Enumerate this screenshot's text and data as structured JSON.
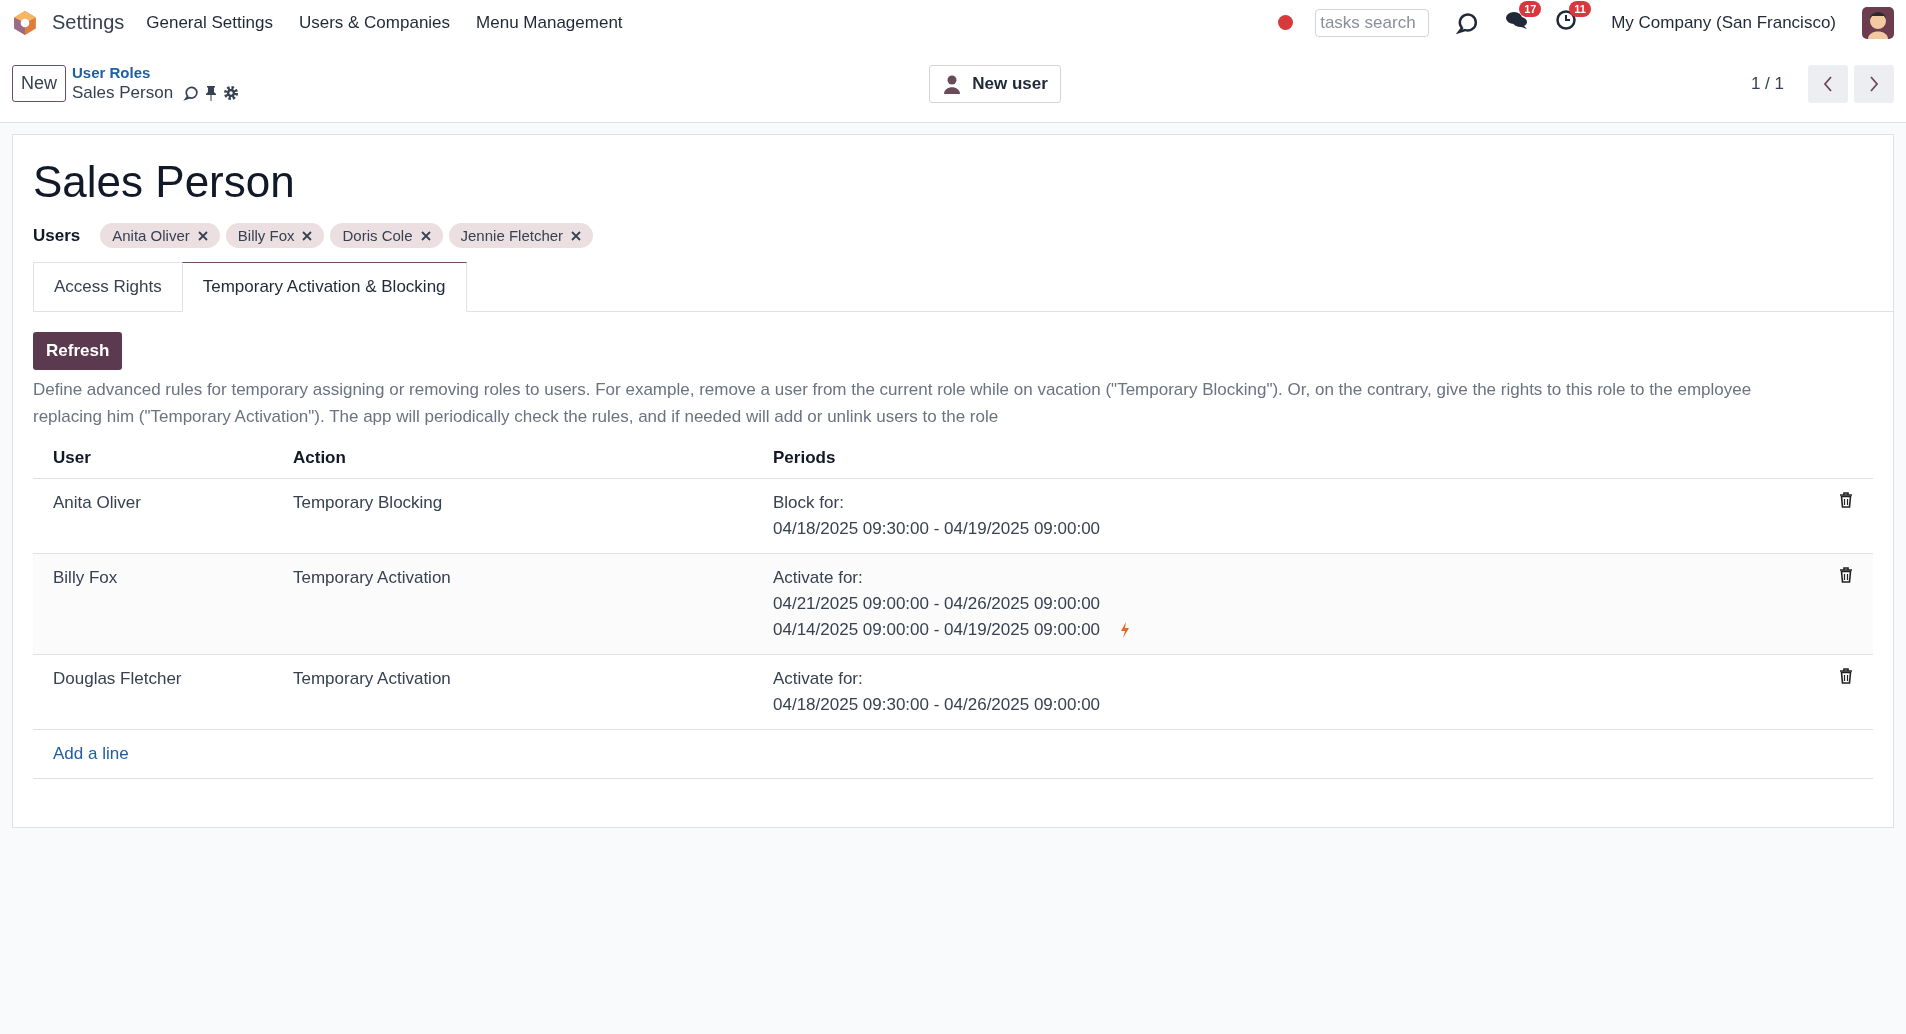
{
  "navbar": {
    "app_name": "Settings",
    "menu": [
      "General Settings",
      "Users & Companies",
      "Menu Management"
    ],
    "search": {
      "placeholder": "tasks search"
    },
    "messages_badge": "17",
    "activities_badge": "11",
    "company": "My Company (San Francisco)"
  },
  "control_panel": {
    "new_button": "New",
    "breadcrumb": "User Roles",
    "record": "Sales Person",
    "action_button": "New user",
    "pager": "1 / 1"
  },
  "form": {
    "title": "Sales Person",
    "users_label": "Users",
    "users": [
      "Anita Oliver",
      "Billy Fox",
      "Doris Cole",
      "Jennie Fletcher"
    ],
    "tabs": [
      {
        "label": "Access Rights",
        "selected": false
      },
      {
        "label": "Temporary Activation & Blocking",
        "selected": true
      }
    ],
    "refresh_button": "Refresh",
    "description": "Define advanced rules for temporary assigning or removing roles to users. For example, remove a user from the current role while on vacation (\"Temporary Blocking\"). Or, on the contrary, give the rights to this role to the employee replacing him (\"Temporary Activation\"). The app will periodically check the rules, and if needed will add or unlink users to the role",
    "table": {
      "columns": [
        "User",
        "Action",
        "Periods"
      ],
      "rows": [
        {
          "user": "Anita Oliver",
          "action": "Temporary Blocking",
          "periods_label": "Block for:",
          "periods": [
            {
              "text": "04/18/2025 09:30:00 - 04/19/2025 09:00:00",
              "active": false
            }
          ]
        },
        {
          "user": "Billy Fox",
          "action": "Temporary Activation",
          "periods_label": "Activate for:",
          "periods": [
            {
              "text": "04/21/2025 09:00:00 - 04/26/2025 09:00:00",
              "active": false
            },
            {
              "text": "04/14/2025 09:00:00 - 04/19/2025 09:00:00",
              "active": true
            }
          ]
        },
        {
          "user": "Douglas Fletcher",
          "action": "Temporary Activation",
          "periods_label": "Activate for:",
          "periods": [
            {
              "text": "04/18/2025 09:30:00 - 04/26/2025 09:00:00",
              "active": false
            }
          ]
        }
      ],
      "add_line": "Add a line"
    }
  }
}
